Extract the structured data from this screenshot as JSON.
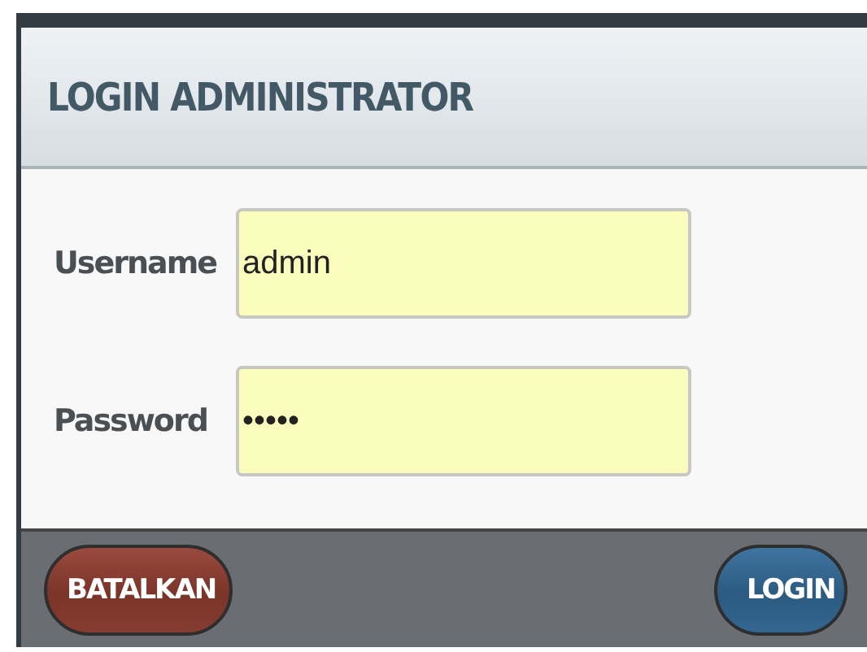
{
  "dialog": {
    "title": "LOGIN ADMINISTRATOR"
  },
  "fields": [
    {
      "label": "Username",
      "value": "admin"
    },
    {
      "label": "Password",
      "value": "•••••"
    }
  ],
  "buttons": [
    {
      "label": "BATALKAN",
      "kind": "cancel"
    },
    {
      "label": "LOGIN",
      "kind": "primary"
    }
  ]
}
